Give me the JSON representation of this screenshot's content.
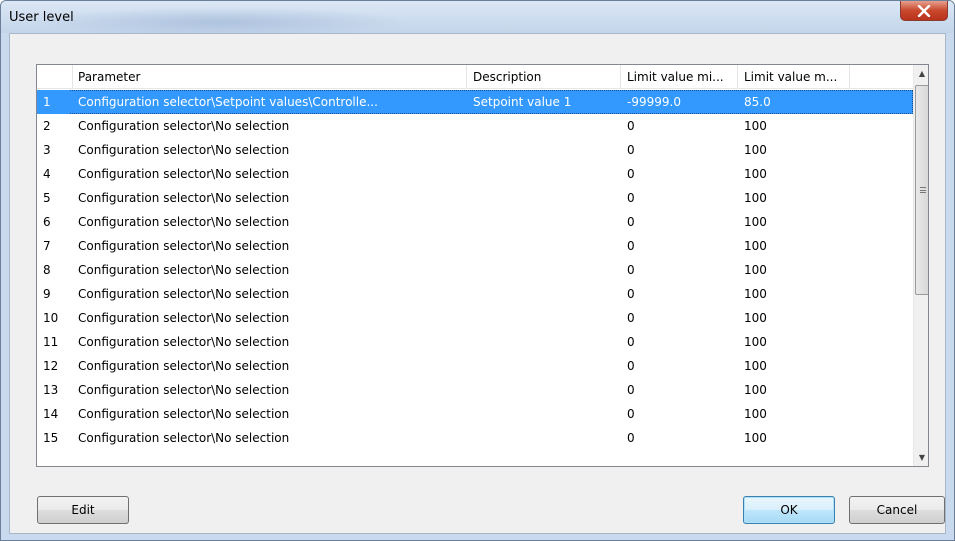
{
  "window": {
    "title": "User level",
    "close_glyph": "x"
  },
  "table": {
    "columns": [
      "",
      "Parameter",
      "Description",
      "Limit value mi...",
      "Limit value m..."
    ],
    "rows": [
      {
        "num": "1",
        "parameter": "Configuration selector\\Setpoint values\\Controlle...",
        "description": "Setpoint value 1",
        "min": "-99999.0",
        "max": "85.0",
        "selected": true
      },
      {
        "num": "2",
        "parameter": "Configuration selector\\No selection",
        "description": "",
        "min": "0",
        "max": "100"
      },
      {
        "num": "3",
        "parameter": "Configuration selector\\No selection",
        "description": "",
        "min": "0",
        "max": "100"
      },
      {
        "num": "4",
        "parameter": "Configuration selector\\No selection",
        "description": "",
        "min": "0",
        "max": "100"
      },
      {
        "num": "5",
        "parameter": "Configuration selector\\No selection",
        "description": "",
        "min": "0",
        "max": "100"
      },
      {
        "num": "6",
        "parameter": "Configuration selector\\No selection",
        "description": "",
        "min": "0",
        "max": "100"
      },
      {
        "num": "7",
        "parameter": "Configuration selector\\No selection",
        "description": "",
        "min": "0",
        "max": "100"
      },
      {
        "num": "8",
        "parameter": "Configuration selector\\No selection",
        "description": "",
        "min": "0",
        "max": "100"
      },
      {
        "num": "9",
        "parameter": "Configuration selector\\No selection",
        "description": "",
        "min": "0",
        "max": "100"
      },
      {
        "num": "10",
        "parameter": "Configuration selector\\No selection",
        "description": "",
        "min": "0",
        "max": "100"
      },
      {
        "num": "11",
        "parameter": "Configuration selector\\No selection",
        "description": "",
        "min": "0",
        "max": "100"
      },
      {
        "num": "12",
        "parameter": "Configuration selector\\No selection",
        "description": "",
        "min": "0",
        "max": "100"
      },
      {
        "num": "13",
        "parameter": "Configuration selector\\No selection",
        "description": "",
        "min": "0",
        "max": "100"
      },
      {
        "num": "14",
        "parameter": "Configuration selector\\No selection",
        "description": "",
        "min": "0",
        "max": "100"
      },
      {
        "num": "15",
        "parameter": "Configuration selector\\No selection",
        "description": "",
        "min": "0",
        "max": "100"
      }
    ]
  },
  "buttons": {
    "edit": "Edit",
    "ok": "OK",
    "cancel": "Cancel"
  },
  "colors": {
    "selection": "#3399ff",
    "title_bar": "#c9daee",
    "close_button": "#c9482e"
  }
}
